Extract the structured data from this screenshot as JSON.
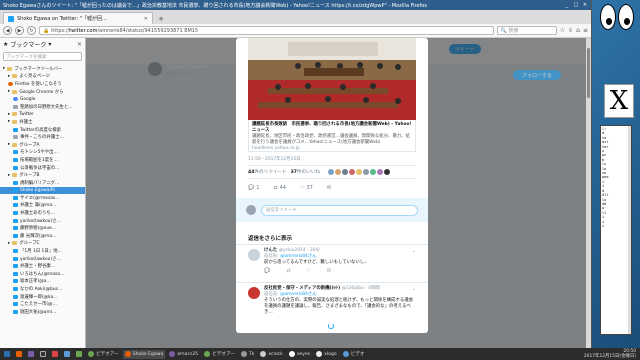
{
  "window": {
    "title": "Shoko Egawaさんのツイート: \"「嘘が回ったのは議会で…」政治宗教基地法 市民選挙、躍り回される市長(地方議会新聞Web) - Yahoo!ニュース https://t.co/zdgWpwP\" - Mozilla Firefox"
  },
  "tab": {
    "label": "Shoko Egawa on Twitter: \"「嘘が回…"
  },
  "url": {
    "scheme": "https://",
    "host": "twitter.com",
    "path": "/amneris84/status/941559293871 8M15"
  },
  "search": {
    "placeholder": "検索"
  },
  "sidebar": {
    "title": "ブックマーク",
    "search_placeholder": "ブックマークを検索",
    "items": [
      {
        "label": "ブックマークツールバー",
        "icon": "folder",
        "depth": 0
      },
      {
        "label": "よく見るページ",
        "icon": "folder",
        "depth": 1
      },
      {
        "label": "Firefox を使いこなそう",
        "icon": "firefox",
        "depth": 1
      },
      {
        "label": "Google Chrome から",
        "icon": "folder",
        "depth": 1
      },
      {
        "label": "Google",
        "icon": "google",
        "depth": 2
      },
      {
        "label": "聖路加の日野原大先生と…",
        "icon": "gray",
        "depth": 2
      },
      {
        "label": "Twitter",
        "icon": "folder",
        "depth": 1
      },
      {
        "label": "弁護士",
        "icon": "folder",
        "depth": 1
      },
      {
        "label": "Twitterの高度な検索",
        "icon": "twitter",
        "depth": 2
      },
      {
        "label": "事件・こちの弁護士…",
        "icon": "gray",
        "depth": 2
      },
      {
        "label": "グループA",
        "icon": "folder",
        "depth": 1
      },
      {
        "label": "モトシシ5やや出…",
        "icon": "twitter",
        "depth": 2
      },
      {
        "label": "技場範囲を1度を…",
        "icon": "twitter",
        "depth": 2
      },
      {
        "label": "公衆戦争は宇宙の…",
        "icon": "twitter",
        "depth": 2
      },
      {
        "label": "グループB",
        "icon": "folder",
        "depth": 1
      },
      {
        "label": "規制編パリアニグ…",
        "icon": "twitter",
        "depth": 2
      },
      {
        "label": "Shoko Egawa/Ri",
        "icon": "twitter",
        "depth": 2,
        "selected": true
      },
      {
        "label": "サイエ(@rmesas…",
        "icon": "twitter",
        "depth": 2
      },
      {
        "label": "弁護士 兼(@ma…",
        "icon": "twitter",
        "depth": 2
      },
      {
        "label": "弁護士あのうち…",
        "icon": "twitter",
        "depth": 2
      },
      {
        "label": "yoriko(lawkou)さ…",
        "icon": "twitter",
        "depth": 2
      },
      {
        "label": "藤野原徳(@oue…",
        "icon": "twitter",
        "depth": 2
      },
      {
        "label": "藤 光輝次(@ma…",
        "icon": "twitter",
        "depth": 2
      },
      {
        "label": "グループC",
        "icon": "folder",
        "depth": 1
      },
      {
        "label": "「1月 1日 1日」地…",
        "icon": "twitter",
        "depth": 2
      },
      {
        "label": "yoriko(lawkou)さ…",
        "icon": "twitter",
        "depth": 2
      },
      {
        "label": "弁護士・野谷康…",
        "icon": "twitter",
        "depth": 2
      },
      {
        "label": "いろはちん(@masa…",
        "icon": "twitter",
        "depth": 2
      },
      {
        "label": "坂本正孝(@a…",
        "icon": "twitter",
        "depth": 2
      },
      {
        "label": "なかの Aoki(@bus…",
        "icon": "twitter",
        "depth": 2
      },
      {
        "label": "渡邊輝一郎(@ka…",
        "icon": "twitter",
        "depth": 2
      },
      {
        "label": "こたえせ一市(@…",
        "icon": "twitter",
        "depth": 2
      },
      {
        "label": "堀田大祐(@umi…",
        "icon": "twitter",
        "depth": 2
      }
    ]
  },
  "background_profile": {
    "name": "Shoko Egawa",
    "handle": "@amneris84",
    "follow_label": "フォローする",
    "top_button": "ツイート"
  },
  "tweet": {
    "card_title": "議題延長市長敗訴　市民選挙、踊り回される市長(地方議会新聞Web) - Yahoo!ニュース",
    "card_desc": "議題延長、地区市民・政治政党、政党運営…議会議員、無関係な処分、暴力、処罰を行う議会を議員がコメ…Yahoo!ニュース(地方議会新聞Web)",
    "card_src": "headlines.yahoo.co.jp",
    "time": "11:59 - 2017年12月15日",
    "retweets_count": "44",
    "retweets_label": "件のリツイート",
    "likes_count": "37",
    "likes_label": "件のいいね",
    "reply_count": "1",
    "retweet_count2": "44",
    "like_count2": "37",
    "reply_placeholder": "返信をツイート"
  },
  "more_replies_heading": "返信をさらに表示",
  "replies": [
    {
      "name": "けんた",
      "handle": "@yckiu2014 · 30分",
      "to_prefix": "返信先:",
      "to": "@amneris84さん",
      "text": "前から思ってるんですけど、難しいもしていないし、",
      "avatar_color": "#c9d3dc"
    },
    {
      "name": "反社民党・保守・メディアの新機(ﾈｯﾄ)",
      "handle": "@330jdbu · 4時間",
      "to_prefix": "返信先:",
      "to": "@amneris84さん",
      "text": "そういうの仕方の、実際の誠実な処理と統けず、もっと関係を構成する議会を議員の議題を議論し、報告、さまざまなもので、「議会的な」の考えるべき…",
      "avatar_color": "#c7372f"
    }
  ],
  "taskbar": {
    "items": [
      {
        "label": "ビデオアー",
        "color": "#6aa84f"
      },
      {
        "label": "Shoko Egawa",
        "color": "#e66000",
        "active": true
      },
      {
        "label": "emacs25",
        "color": "#7b5ea7"
      },
      {
        "label": "ビデオアー",
        "color": "#6aa84f"
      },
      {
        "label": "Tk",
        "color": "#999999"
      },
      {
        "label": "xclock",
        "color": "#cccccc"
      },
      {
        "label": "xeyes",
        "color": "#ffffff"
      },
      {
        "label": "xlogo",
        "color": "#eeeeee"
      },
      {
        "label": "ビデオ",
        "color": "#5a9bd5"
      }
    ],
    "time": "20:50",
    "date": "2017年12月15日(金曜日)"
  },
  "xterm_lines": [
    "l:",
    "d",
    "ta",
    "dir",
    "tar",
    "u",
    "pc",
    "b",
    "lc",
    "lo",
    "ve",
    "wee",
    "i",
    "i",
    "d",
    "dll",
    "lo",
    "dd",
    "w",
    "ll",
    "i",
    "i",
    "i"
  ],
  "colors": {
    "twitter_blue": "#1da1f2",
    "accent_selected": "#3d8fd8",
    "titlebar": "#2f5e8c"
  }
}
